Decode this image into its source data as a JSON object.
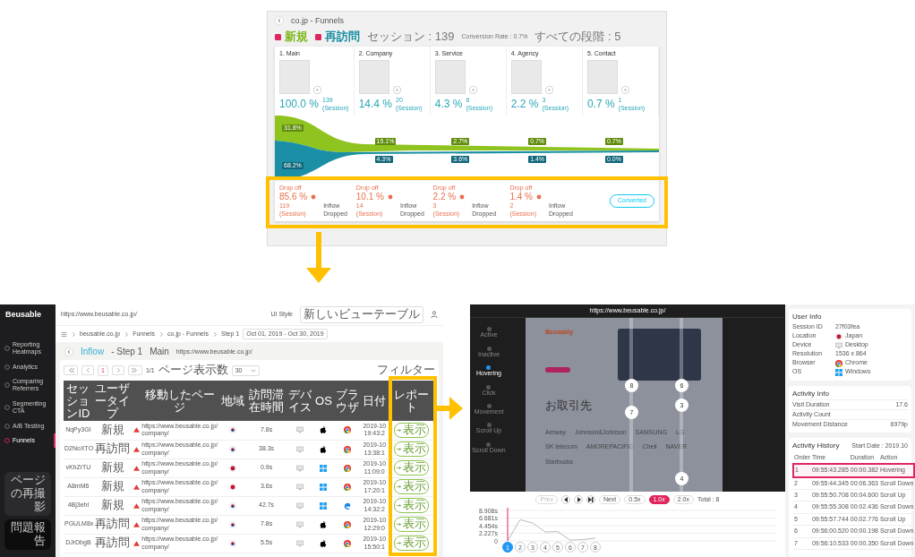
{
  "funnel_window": {
    "title": "co.jp - Funnels",
    "legend": [
      {
        "label": "新規",
        "checked": true,
        "color": "#7cb518"
      },
      {
        "label": "再訪問",
        "checked": true,
        "color": "#1a8fa5"
      }
    ],
    "stats": [
      "セッション : 139",
      "Conversion Rate : 0.7%",
      "すべての段階 : 5"
    ],
    "steps": [
      {
        "name": "1. Main",
        "percent": "100.0 %",
        "count": "139",
        "unit": "(Session)",
        "new_share": "31.8%",
        "returning_share": "68.2%"
      },
      {
        "name": "2. Company",
        "percent": "14.4 %",
        "count": "20",
        "unit": "(Session)",
        "new_share": "15.1%",
        "returning_share": "4.3%"
      },
      {
        "name": "3. Service",
        "percent": "4.3 %",
        "count": "6",
        "unit": "(Session)",
        "new_share": "2.7%",
        "returning_share": "3.6%"
      },
      {
        "name": "4. Agency",
        "percent": "2.2 %",
        "count": "3",
        "unit": "(Session)",
        "new_share": "0.7%",
        "returning_share": "1.4%"
      },
      {
        "name": "5. Contact",
        "percent": "0.7 %",
        "count": "1",
        "unit": "(Session)",
        "new_share": "0.7%",
        "returning_share": "0.0%"
      }
    ],
    "dropoffs": [
      {
        "label": "Drop off",
        "percent": "85.6 %",
        "count": "119",
        "unit": "(Session)",
        "inflow": "Inflow",
        "dropped": "Dropped"
      },
      {
        "label": "Drop off",
        "percent": "10.1 %",
        "count": "14",
        "unit": "(Session)",
        "inflow": "Inflow",
        "dropped": "Dropped"
      },
      {
        "label": "Drop off",
        "percent": "2.2 %",
        "count": "3",
        "unit": "(Session)",
        "inflow": "Inflow",
        "dropped": "Dropped"
      },
      {
        "label": "Drop off",
        "percent": "1.4 %",
        "count": "2",
        "unit": "(Session)",
        "inflow": "Inflow",
        "dropped": "Dropped"
      }
    ],
    "converted_button": "Converted"
  },
  "report_window": {
    "brand": "Beusable",
    "nav": [
      {
        "label": "Reporting Heatmaps",
        "selected": false
      },
      {
        "label": "Analytics",
        "selected": false
      },
      {
        "label": "Comparing Referrers",
        "selected": false
      },
      {
        "label": "Segmenting CTA",
        "selected": false
      },
      {
        "label": "A/B Testing",
        "selected": false
      },
      {
        "label": "Funnels",
        "selected": true
      }
    ],
    "sidebar_buttons": [
      "ページの再撮影",
      "問題報告"
    ],
    "site_url": "https://www.beusable.co.jp/",
    "ui_style_label": "UI Style",
    "ui_style_value": "新しいビューテーブル",
    "breadcrumb": [
      "beusable.co.jp",
      "Funnels",
      "co.jp - Funnels",
      "Step 1"
    ],
    "date_range": "Oct 01, 2019 - Oct 30, 2019",
    "heading": {
      "kind": "inflow",
      "title": "Inflow",
      "step": "- Step 1",
      "page": "Main",
      "url": "https://www.beusable.co.jp/"
    },
    "pagination": {
      "current": "1",
      "total": "1/1",
      "per_page_label": "ページ表示数",
      "per_page": "30"
    },
    "filter": "フィルター",
    "columns": [
      "セッションID",
      "ユーザータイプ",
      "移動したページ",
      "地域",
      "訪問滞在時間",
      "デバイス",
      "OS",
      "ブラウザ",
      "日付",
      "レポート"
    ],
    "rows": [
      {
        "session": "NqPy3GI",
        "type": "新規",
        "page": "https://www.beusable.co.jp/company/",
        "flag": {
          "kind": "kr"
        },
        "duration": "7.8s",
        "os": {
          "kind": "apple"
        },
        "browser": {
          "kind": "chrome"
        },
        "date": "2019-10",
        "time": "19:43:2",
        "report": "表示"
      },
      {
        "session": "D2NoXTO",
        "type": "再訪問",
        "page": "https://www.beusable.co.jp/company/",
        "flag": {
          "kind": "kr"
        },
        "duration": "38.3s",
        "os": {
          "kind": "apple"
        },
        "browser": {
          "kind": "chrome"
        },
        "date": "2019-10",
        "time": "13:38:1",
        "report": "表示"
      },
      {
        "session": "vKhZrTU",
        "type": "新規",
        "page": "https://www.beusable.co.jp/company/",
        "flag": {
          "kind": "jp"
        },
        "duration": "0.9s",
        "os": {
          "kind": "windows"
        },
        "browser": {
          "kind": "chrome"
        },
        "date": "2019-10",
        "time": "11:09:0",
        "report": "表示"
      },
      {
        "session": "A8mM6",
        "type": "新規",
        "page": "https://www.beusable.co.jp/company/",
        "flag": {
          "kind": "jp"
        },
        "duration": "3.6s",
        "os": {
          "kind": "windows"
        },
        "browser": {
          "kind": "chrome"
        },
        "date": "2019-10",
        "time": "17:20:1",
        "report": "表示"
      },
      {
        "session": "4Bj3ehl",
        "type": "新規",
        "page": "https://www.beusable.co.jp/company/",
        "flag": {
          "kind": "kr"
        },
        "duration": "42.7s",
        "os": {
          "kind": "windows"
        },
        "browser": {
          "kind": "edge"
        },
        "date": "2019-10",
        "time": "14:32:2",
        "report": "表示"
      },
      {
        "session": "PGULM8x",
        "type": "再訪問",
        "page": "https://www.beusable.co.jp/company/",
        "flag": {
          "kind": "kr"
        },
        "duration": "7.8s",
        "os": {
          "kind": "apple"
        },
        "browser": {
          "kind": "chrome"
        },
        "date": "2019-10",
        "time": "12:29:0",
        "report": "表示"
      },
      {
        "session": "DJrDbgB",
        "type": "再訪問",
        "page": "https://www.beusable.co.jp/company/",
        "flag": {
          "kind": "kr"
        },
        "duration": "5.5s",
        "os": {
          "kind": "apple"
        },
        "browser": {
          "kind": "chrome"
        },
        "date": "2019-10",
        "time": "15:50:1",
        "report": "表示"
      }
    ]
  },
  "replay_window": {
    "url": "https://www.beusable.co.jp/",
    "modes": [
      {
        "label": "Active",
        "selected": false
      },
      {
        "label": "Inactive",
        "selected": false
      },
      {
        "label": "Hovering",
        "selected": true
      },
      {
        "label": "Click",
        "selected": false
      },
      {
        "label": "Movement",
        "selected": false
      },
      {
        "label": "Scroll Up",
        "selected": false
      },
      {
        "label": "Scroll Down",
        "selected": false
      }
    ],
    "site": {
      "title": "Beusably",
      "section": "お取引先",
      "logos": [
        "Amway",
        "Johnson&Johnson",
        "SAMSUNG",
        "LG",
        "SK telecom",
        "AMOREPACIFIC",
        "Cheil",
        "NAVER",
        "Starbucks"
      ]
    },
    "markers": [
      "8",
      "6",
      "3",
      "7",
      "4"
    ],
    "controls": {
      "prev": "Prev",
      "next": "Next",
      "speeds": [
        {
          "label": "0.5x",
          "selected": false
        },
        {
          "label": "1.0x",
          "selected": true
        },
        {
          "label": "2.0x",
          "selected": false
        }
      ],
      "total": "Total : 8"
    },
    "chart_data": {
      "type": "line",
      "categories": [
        "1",
        "2",
        "3",
        "4",
        "5",
        "6",
        "7",
        "8"
      ],
      "series": [
        {
          "color": "#bbbbbb",
          "values": [
            0.1,
            6.2,
            5.2,
            2.6,
            2.7,
            0.2,
            0.4,
            0.8
          ]
        }
      ],
      "ylim": [
        0,
        8.908
      ],
      "yticks": [
        {
          "value": 0,
          "label": "0"
        },
        {
          "value": 2.227,
          "label": "2.227s"
        },
        {
          "value": 4.454,
          "label": "4.454s"
        },
        {
          "value": 6.681,
          "label": "6.681s"
        },
        {
          "value": 8.908,
          "label": "8.908s"
        }
      ],
      "grid": true
    },
    "pages": [
      {
        "selected": true
      },
      {
        "selected": false
      },
      {
        "selected": false
      },
      {
        "selected": false
      },
      {
        "selected": false
      },
      {
        "selected": false
      },
      {
        "selected": false
      },
      {
        "selected": false
      }
    ],
    "user_info": {
      "title": "User Info",
      "fields": [
        {
          "label": "Session ID",
          "value": "27f03fea"
        },
        {
          "label": "Location",
          "value": "Japan",
          "icon": {
            "kind": "jp"
          }
        },
        {
          "label": "Device",
          "value": "Desktop",
          "icon": {
            "kind": "desktop"
          }
        },
        {
          "label": "Resolution",
          "value": "1536 x 864"
        },
        {
          "label": "Browser",
          "value": "Chrome",
          "icon": {
            "kind": "chrome"
          }
        },
        {
          "label": "OS",
          "value": "Windows",
          "icon": {
            "kind": "windows"
          }
        }
      ]
    },
    "activity_info": {
      "title": "Activity Info",
      "fields": [
        {
          "label": "Visit Duration",
          "value": "17.6"
        },
        {
          "label": "Activity Count"
        },
        {
          "label": "Movement Distance",
          "value": "6979p"
        }
      ]
    },
    "activity_history": {
      "title": "Activity History",
      "start_date": "Start Date : 2019.10",
      "columns": [
        "Order",
        "Time",
        "Duration",
        "Action"
      ],
      "rows": [
        {
          "order": "1",
          "time": "09:55:43.285",
          "duration": "00:00.382",
          "action": "Hovering",
          "selected": true
        },
        {
          "order": "2",
          "time": "09:55:44.345",
          "duration": "00:06.363",
          "action": "Scroll Down",
          "selected": false
        },
        {
          "order": "3",
          "time": "09:55:50.708",
          "duration": "00:04.600",
          "action": "Scroll Up",
          "selected": false
        },
        {
          "order": "4",
          "time": "09:55:55.308",
          "duration": "00:02.436",
          "action": "Scroll Down",
          "selected": false
        },
        {
          "order": "5",
          "time": "09:55:57.744",
          "duration": "00:02.776",
          "action": "Scroll Up",
          "selected": false
        },
        {
          "order": "6",
          "time": "09:56:00.520",
          "duration": "00:00.198",
          "action": "Scroll Down",
          "selected": false
        },
        {
          "order": "7",
          "time": "09:56:10.533",
          "duration": "00:00.350",
          "action": "Scroll Down",
          "selected": false
        }
      ]
    }
  }
}
